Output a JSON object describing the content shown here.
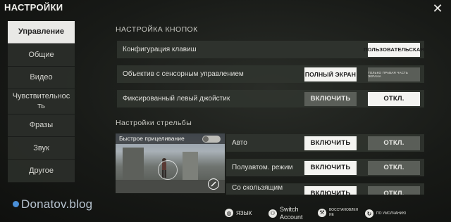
{
  "window": {
    "title": "НАСТРОЙКИ",
    "close_glyph": "✕"
  },
  "sidebar": {
    "items": [
      {
        "label": "Управление",
        "active": true
      },
      {
        "label": "Общие"
      },
      {
        "label": "Видео"
      },
      {
        "label": "Чувствительность"
      },
      {
        "label": "Фразы"
      },
      {
        "label": "Звук"
      },
      {
        "label": "Другое"
      }
    ]
  },
  "button_settings": {
    "title": "НАСТРОЙКА КНОПОК",
    "key_config": {
      "label": "Конфигурация клавиш",
      "value": "ПОЛЬЗОВАТЕЛЬСКАЯ"
    },
    "touch_scope": {
      "label": "Объектив с сенсорным управлением",
      "option_full": "ПОЛНЫЙ ЭКРАН",
      "option_right": "ТОЛЬКО ПРАВАЯ ЧАСТЬ ЭКРАНА"
    },
    "fixed_joystick": {
      "label": "Фиксированный левый джойстик",
      "on": "ВКЛЮЧИТЬ",
      "off": "ОТКЛ."
    }
  },
  "shooting_settings": {
    "title": "Настройки стрельбы",
    "preview_label": "Быстрое прицеливание",
    "rows": [
      {
        "label": "Авто",
        "on": "ВКЛЮЧИТЬ",
        "off": "ОТКЛ."
      },
      {
        "label": "Полуавтом. режим",
        "on": "ВКЛЮЧИТЬ",
        "off": "ОТКЛ."
      },
      {
        "label": "Со скользящим",
        "on": "ВКЛЮЧИТЬ",
        "off": "ОТКЛ."
      }
    ]
  },
  "bottom": {
    "language": "ЯЗЫК",
    "switch_account_1": "Switch",
    "switch_account_2": "Account",
    "restore_1": "ВОССТАНОВЛЕН",
    "restore_2": "ИЕ",
    "default": "ПО УМОЛЧАНИЮ"
  },
  "watermark": "Donatov.blog",
  "colors": {
    "accent_on": "#f4f4f1",
    "off_button": "#5a5e58",
    "row_bg": "#30342f"
  }
}
